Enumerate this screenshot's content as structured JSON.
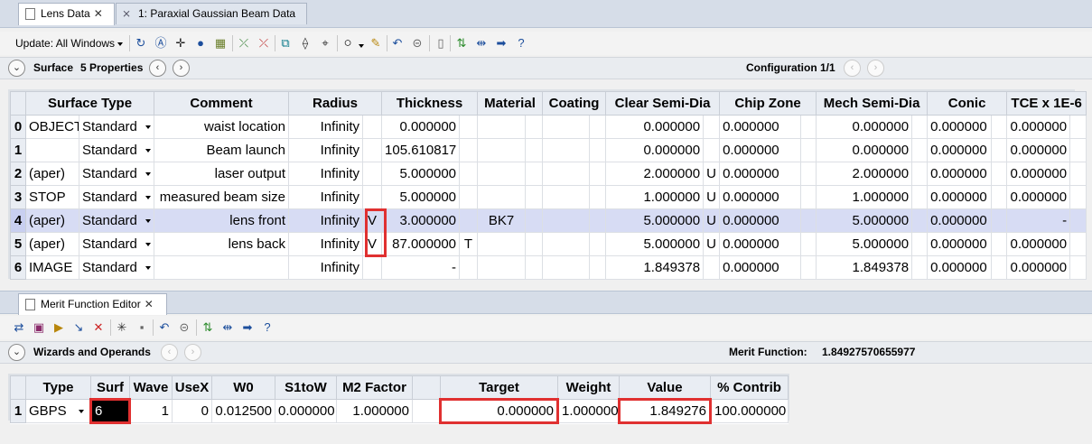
{
  "top_tabs": [
    {
      "label": "Lens Data",
      "active": true,
      "close": "✕"
    },
    {
      "label": "1: Paraxial Gaussian Beam Data",
      "active": false
    }
  ],
  "toolbar": {
    "update_label": "Update: All Windows"
  },
  "surface_bar": {
    "label": "Surface",
    "properties": "5 Properties",
    "configuration": "Configuration 1/1"
  },
  "lens_table": {
    "headers": [
      "",
      "Surface Type",
      "",
      "Comment",
      "Radius",
      "",
      "Thickness",
      "",
      "Material",
      "",
      "Coating",
      "",
      "Clear Semi-Dia",
      "",
      "Chip Zone",
      "",
      "Mech Semi-Dia",
      "",
      "Conic",
      "",
      "TCE x 1E-6",
      ""
    ],
    "header_labels": {
      "surface_type": "Surface Type",
      "comment": "Comment",
      "radius": "Radius",
      "thickness": "Thickness",
      "material": "Material",
      "coating": "Coating",
      "clear_semi_dia": "Clear Semi-Dia",
      "chip_zone": "Chip Zone",
      "mech_semi_dia": "Mech Semi-Dia",
      "conic": "Conic",
      "tce": "TCE x 1E-6"
    },
    "rows": [
      {
        "num": "0",
        "name": "OBJECT",
        "type": "Standard",
        "comment": "waist location",
        "radius": "Infinity",
        "radius_solve": "",
        "thickness": "0.000000",
        "thickness_solve": "",
        "material": "",
        "coating": "",
        "clear": "0.000000",
        "clear_solve": "",
        "chip": "0.000000",
        "mech": "0.000000",
        "conic": "0.000000",
        "tce": "0.000000"
      },
      {
        "num": "1",
        "name": "",
        "type": "Standard",
        "comment": "Beam launch",
        "radius": "Infinity",
        "radius_solve": "",
        "thickness": "105.610817",
        "thickness_solve": "",
        "material": "",
        "coating": "",
        "clear": "0.000000",
        "clear_solve": "",
        "chip": "0.000000",
        "mech": "0.000000",
        "conic": "0.000000",
        "tce": "0.000000"
      },
      {
        "num": "2",
        "name": "(aper)",
        "type": "Standard",
        "comment": "laser output",
        "radius": "Infinity",
        "radius_solve": "",
        "thickness": "5.000000",
        "thickness_solve": "",
        "material": "",
        "coating": "",
        "clear": "2.000000",
        "clear_solve": "U",
        "chip": "0.000000",
        "mech": "2.000000",
        "conic": "0.000000",
        "tce": "0.000000"
      },
      {
        "num": "3",
        "name": "STOP",
        "type": "Standard",
        "comment": "measured beam size",
        "radius": "Infinity",
        "radius_solve": "",
        "thickness": "5.000000",
        "thickness_solve": "",
        "material": "",
        "coating": "",
        "clear": "1.000000",
        "clear_solve": "U",
        "chip": "0.000000",
        "mech": "1.000000",
        "conic": "0.000000",
        "tce": "0.000000"
      },
      {
        "num": "4",
        "name": "(aper)",
        "type": "Standard",
        "comment": "lens front",
        "radius": "Infinity",
        "radius_solve": "V",
        "thickness": "3.000000",
        "thickness_solve": "",
        "material": "BK7",
        "coating": "",
        "clear": "5.000000",
        "clear_solve": "U",
        "chip": "0.000000",
        "mech": "5.000000",
        "conic": "0.000000",
        "tce": "-",
        "selected": true
      },
      {
        "num": "5",
        "name": "(aper)",
        "type": "Standard",
        "comment": "lens back",
        "radius": "Infinity",
        "radius_solve": "V",
        "thickness": "87.000000",
        "thickness_solve": "T",
        "material": "",
        "coating": "",
        "clear": "5.000000",
        "clear_solve": "U",
        "chip": "0.000000",
        "mech": "5.000000",
        "conic": "0.000000",
        "tce": "0.000000"
      },
      {
        "num": "6",
        "name": "IMAGE",
        "type": "Standard",
        "comment": "",
        "radius": "Infinity",
        "radius_solve": "",
        "thickness": "-",
        "thickness_solve": "",
        "material": "",
        "coating": "",
        "clear": "1.849378",
        "clear_solve": "",
        "chip": "0.000000",
        "mech": "1.849378",
        "conic": "0.000000",
        "tce": "0.000000"
      }
    ]
  },
  "merit_tab": {
    "label": "Merit Function Editor",
    "close": "✕"
  },
  "wizards_bar": {
    "label": "Wizards and Operands",
    "merit_label": "Merit Function:",
    "merit_value": "1.84927570655977"
  },
  "merit_table": {
    "headers": {
      "type": "Type",
      "surf": "Surf",
      "wave": "Wave",
      "usex": "UseX",
      "w0": "W0",
      "s1tow": "S1toW",
      "m2": "M2 Factor",
      "target": "Target",
      "weight": "Weight",
      "value": "Value",
      "contrib": "% Contrib"
    },
    "rows": [
      {
        "num": "1",
        "type": "GBPS",
        "surf": "6",
        "wave": "1",
        "usex": "0",
        "w0": "0.012500",
        "s1tow": "0.000000",
        "m2": "1.000000",
        "target": "0.000000",
        "weight": "1.000000",
        "value": "1.849276",
        "contrib": "100.000000"
      }
    ]
  },
  "icons": [
    "refresh-icon",
    "aperture-icon",
    "crosshair-icon",
    "globe-icon",
    "map-icon",
    "wand-icon",
    "zoom-fit-icon",
    "rays-icon",
    "lens-icon",
    "circle-icon",
    "paint-icon",
    "undo-icon",
    "toggle-icon",
    "document-icon",
    "sync-icon",
    "arrows-icon",
    "arrow-right-icon",
    "help-icon"
  ],
  "colors": {
    "highlight": "#e03030",
    "selected_row": "#d7dcf4",
    "header_bg": "#e9edf3",
    "accent": "#1c4e9c"
  }
}
